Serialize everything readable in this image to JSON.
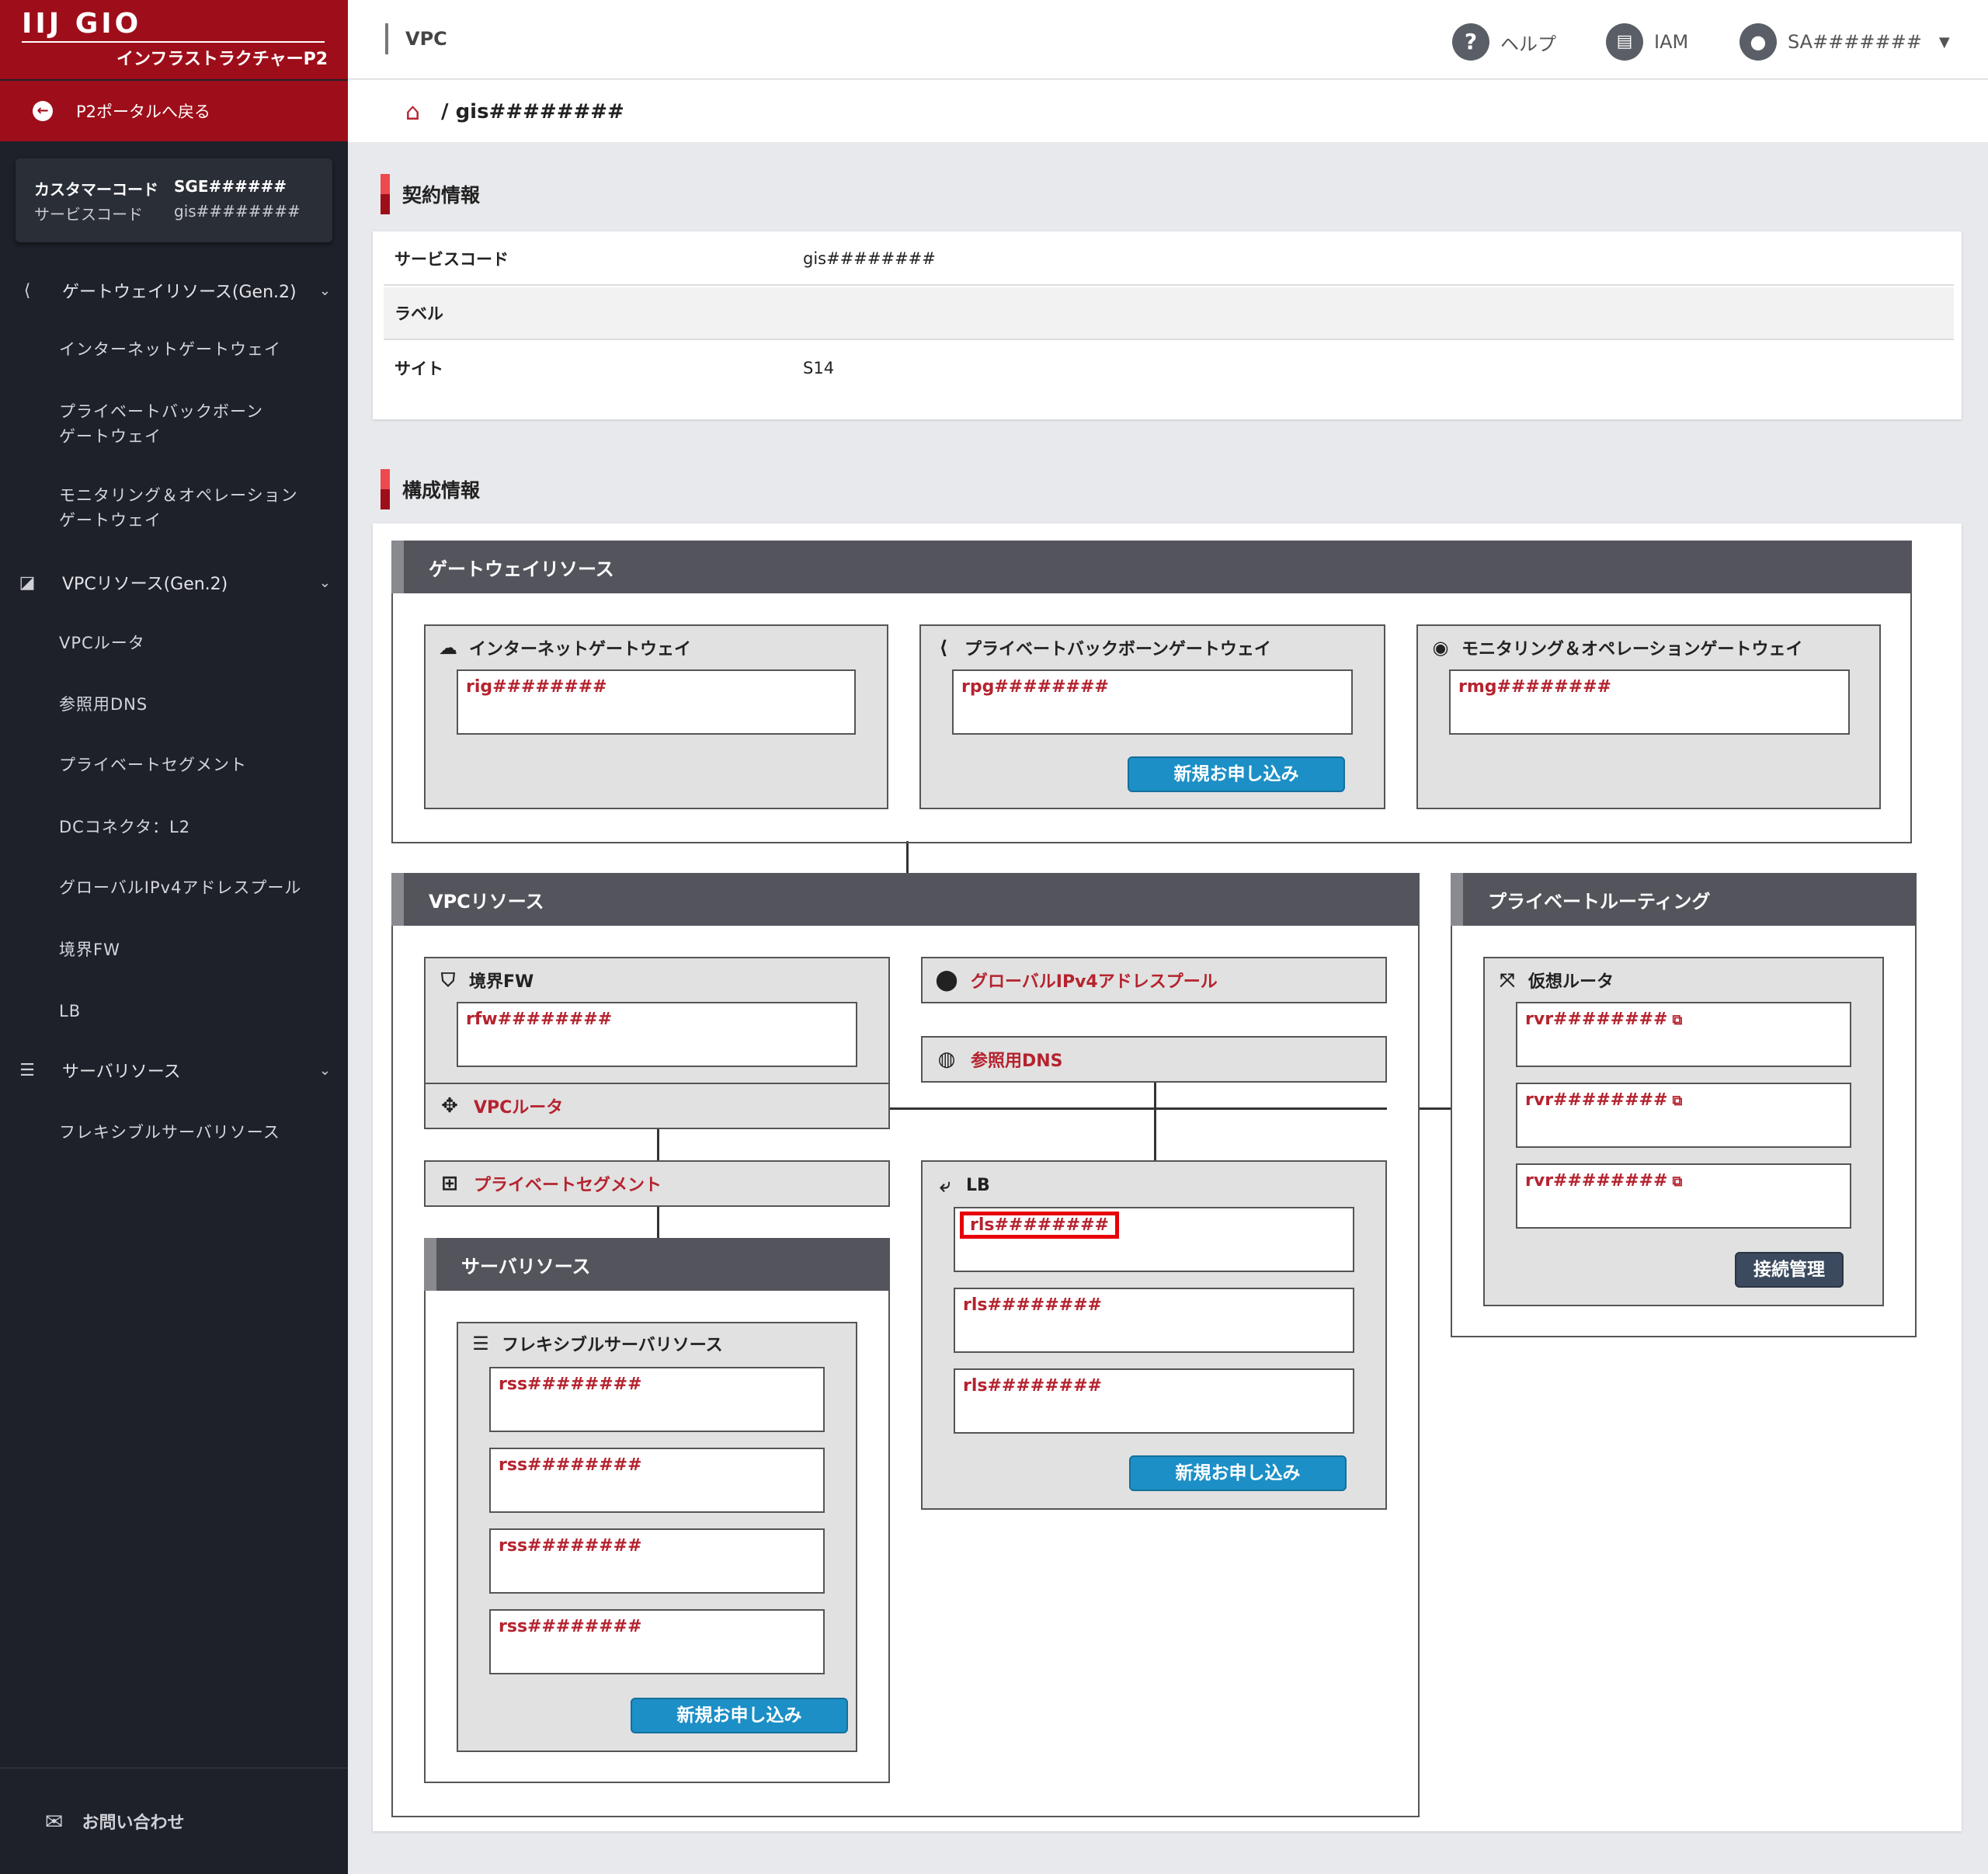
{
  "brand": {
    "logo": "IIJ GIO",
    "subtitle": "インフラストラクチャーP2"
  },
  "sidebar": {
    "back_label": "P2ポータルへ戻る",
    "customer_code_label": "カスタマーコード",
    "customer_code": "SGE######",
    "service_code_label": "サービスコード",
    "service_code": "gis########",
    "sections": [
      {
        "label": "ゲートウェイリソース(Gen.2)",
        "icon": "share-icon",
        "items": [
          "インターネットゲートウェイ",
          "プライベートバックボーン\nゲートウェイ",
          "モニタリング＆オペレーション\nゲートウェイ"
        ]
      },
      {
        "label": "VPCリソース(Gen.2)",
        "icon": "share-square-icon",
        "items": [
          "VPCルータ",
          "参照用DNS",
          "プライベートセグメント",
          "DCコネクタ：L2",
          "グローバルIPv4アドレスプール",
          "境界FW",
          "LB"
        ]
      },
      {
        "label": "サーバリソース",
        "icon": "server-icon",
        "items": [
          "フレキシブルサーバリソース"
        ]
      }
    ],
    "contact_label": "お問い合わせ"
  },
  "header": {
    "title": "VPC",
    "help": "ヘルプ",
    "iam": "IAM",
    "user": "SA#######"
  },
  "breadcrumb": {
    "current": "gis########"
  },
  "contract": {
    "title": "契約情報",
    "rows": [
      {
        "key": "サービスコード",
        "value": "gis########"
      },
      {
        "key": "ラベル",
        "value": ""
      },
      {
        "key": "サイト",
        "value": "S14"
      }
    ]
  },
  "config": {
    "title": "構成情報",
    "gateway": {
      "title": "ゲートウェイリソース",
      "igw": {
        "label": "インターネットゲートウェイ",
        "id": "rig########"
      },
      "pbg": {
        "label": "プライベートバックボーンゲートウェイ",
        "id": "rpg########",
        "button": "新規お申し込み"
      },
      "mog": {
        "label": "モニタリング＆オペレーションゲートウェイ",
        "id": "rmg########"
      }
    },
    "vpc": {
      "title": "VPCリソース",
      "fw": {
        "label": "境界FW",
        "id": "rfw########"
      },
      "router": "VPCルータ",
      "pool": "グローバルIPv4アドレスプール",
      "dns": "参照用DNS",
      "segment": "プライベートセグメント",
      "lb": {
        "label": "LB",
        "ids": [
          "rls########",
          "rls########",
          "rls########"
        ],
        "button": "新規お申し込み"
      },
      "server": {
        "title": "サーバリソース",
        "label": "フレキシブルサーバリソース",
        "ids": [
          "rss########",
          "rss########",
          "rss########",
          "rss########"
        ],
        "button": "新規お申し込み"
      }
    },
    "routing": {
      "title": "プライベートルーティング",
      "label": "仮想ルータ",
      "ids": [
        "rvr########",
        "rvr########",
        "rvr########"
      ],
      "button": "接続管理"
    }
  }
}
